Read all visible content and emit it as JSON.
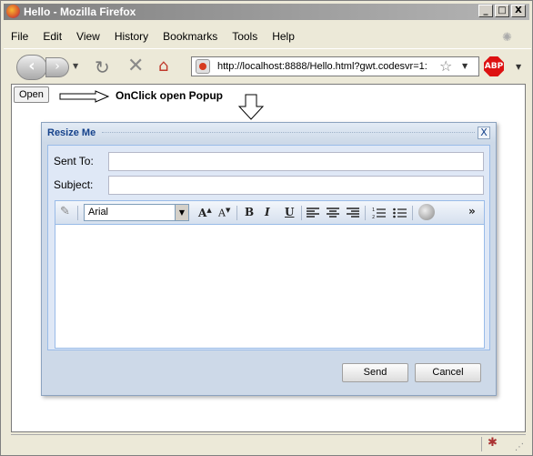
{
  "window": {
    "title": "Hello - Mozilla Firefox",
    "buttons": {
      "minimize": "_",
      "maximize": "□",
      "close": "X"
    }
  },
  "menu": {
    "items": [
      "File",
      "Edit",
      "View",
      "History",
      "Bookmarks",
      "Tools",
      "Help"
    ]
  },
  "navbar": {
    "url": "http://localhost:8888/Hello.html?gwt.codesvr=1:",
    "abp_label": "ABP",
    "icons": [
      "back-icon",
      "forward-icon",
      "reload-icon",
      "stop-icon",
      "home-icon",
      "bookmark-star-icon",
      "adblock-icon"
    ]
  },
  "page": {
    "open_button": "Open",
    "hint_text": "OnClick open Popup"
  },
  "dialog": {
    "title": "Resize Me",
    "close_glyph": "X",
    "sent_to_label": "Sent To:",
    "subject_label": "Subject:",
    "sent_to_value": "",
    "subject_value": "",
    "font_name": "Arial",
    "toolbar": {
      "grow_font": "A",
      "shrink_font": "A",
      "bold": "B",
      "italic": "I",
      "underline": "U",
      "more": "»"
    },
    "send_label": "Send",
    "cancel_label": "Cancel"
  },
  "colors": {
    "dialog_bg": "#cdd9e8",
    "dialog_title": "#15428b",
    "accent_border": "#99bbe8"
  }
}
